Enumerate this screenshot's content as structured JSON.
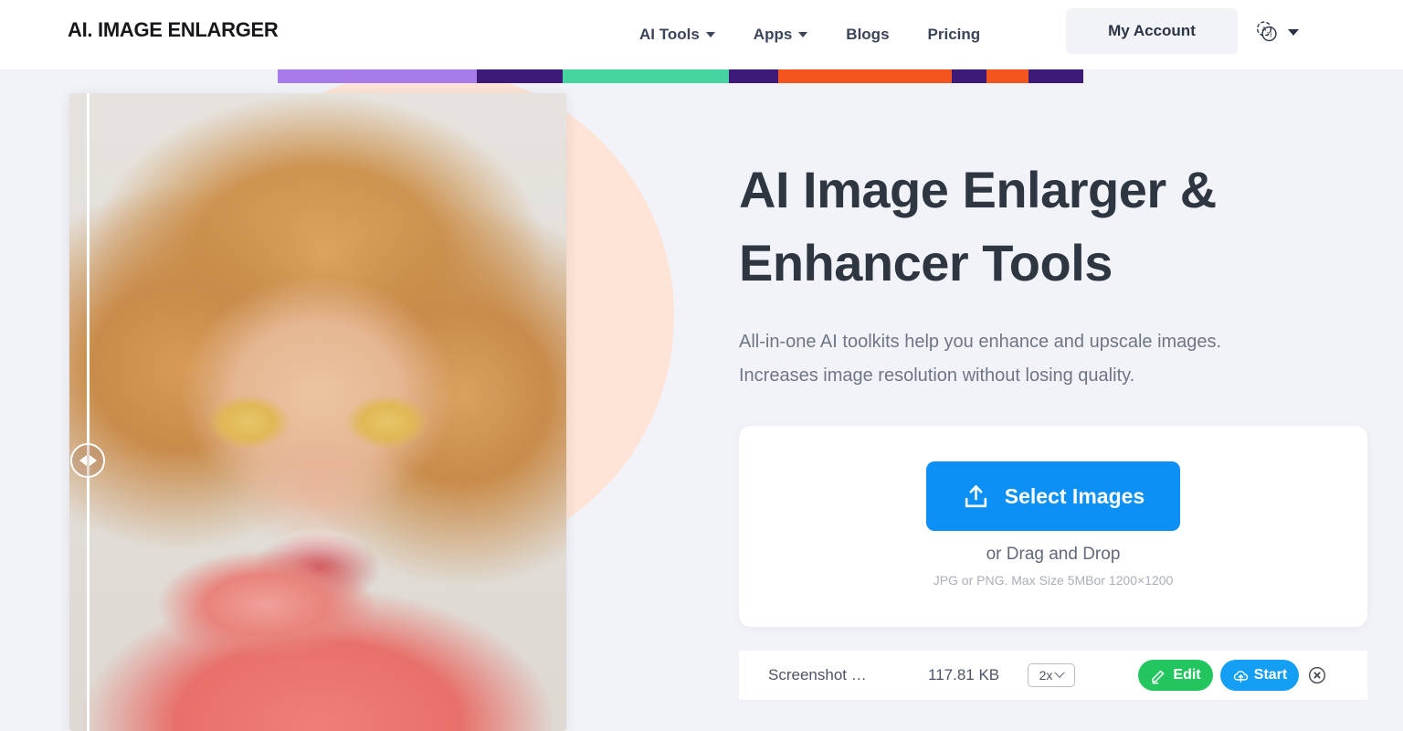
{
  "header": {
    "logo": "AI. IMAGE ENLARGER",
    "nav": [
      {
        "label": "AI Tools",
        "has_caret": true,
        "icon": "chevron-down-icon"
      },
      {
        "label": "Apps",
        "has_caret": true,
        "icon": "chevron-down-icon"
      },
      {
        "label": "Blogs",
        "has_caret": false
      },
      {
        "label": "Pricing",
        "has_caret": false
      }
    ],
    "account_label": "My Account",
    "language_icon": "language-translate-icon",
    "language_caret_icon": "chevron-down-icon"
  },
  "decor": {
    "strip_colors": [
      "#a77ce8",
      "#3d1a78",
      "#46d4a0",
      "#3d1a78",
      "#f4551f",
      "#3d1a78"
    ],
    "circle_color": "#fde4d6",
    "page_background": "#f2f3f8"
  },
  "preview": {
    "slider_handle_icon": "compare-slider-handle-icon",
    "arrow_left_icon": "triangle-left-icon",
    "arrow_right_icon": "triangle-right-icon"
  },
  "hero": {
    "title_line1": "AI Image Enlarger &",
    "title_line2": "Enhancer Tools",
    "subtitle_line1": "All-in-one AI toolkits help you enhance and upscale images.",
    "subtitle_line2": "Increases image resolution without losing quality."
  },
  "upload": {
    "select_label": "Select Images",
    "select_icon": "upload-icon",
    "select_color": "#0d90f5",
    "drag_text": "or Drag and Drop",
    "formats_text": "JPG or PNG. Max Size 5MBor 1200×1200"
  },
  "file_row": {
    "name": "Screenshot …",
    "size": "117.81 KB",
    "scale_value": "2x",
    "scale_caret_icon": "chevron-down-icon",
    "edit_label": "Edit",
    "edit_icon": "pencil-icon",
    "edit_color": "#22c55e",
    "start_label": "Start",
    "start_icon": "cloud-upload-icon",
    "start_color": "#159ff4",
    "remove_icon": "close-circle-icon"
  }
}
